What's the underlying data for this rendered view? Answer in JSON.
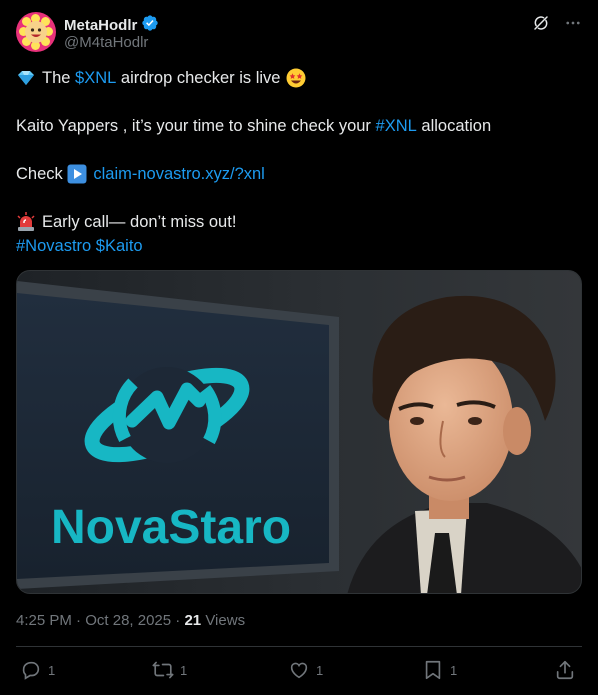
{
  "author": {
    "display_name": "MetaHodlr",
    "handle": "@M4taHodlr",
    "verified": true
  },
  "tweet": {
    "line1_pre": "The ",
    "line1_cashtag": "$XNL",
    "line1_post": " airdrop checker is live",
    "line2_pre": "Kaito Yappers , it’s your time to shine check your ",
    "line2_hashtag": "#XNL",
    "line2_post": " allocation",
    "line3_pre": "Check ",
    "line3_link": "claim-novastro.xyz/?xnl",
    "line4_text": "Early call— don’t miss out!",
    "line5_hashtag1": "#Novastro",
    "line5_cashtag": "$Kaito"
  },
  "media": {
    "logo_text": "NovaStaro",
    "accent_color": "#17b7c4"
  },
  "meta": {
    "time": "4:25 PM",
    "separator": " · ",
    "date": "Oct 28, 2025",
    "views_count": "21",
    "views_label": " Views"
  },
  "actions": {
    "replies": "1",
    "reposts": "1",
    "likes": "1",
    "bookmarks": "1"
  },
  "icons": [
    "verified-badge-icon",
    "grok-icon",
    "more-icon",
    "diamond-emoji-icon",
    "star-struck-emoji-icon",
    "play-button-emoji-icon",
    "siren-emoji-icon",
    "reply-icon",
    "repost-icon",
    "like-icon",
    "bookmark-icon",
    "share-icon"
  ],
  "colors": {
    "link": "#1d9bf0",
    "muted": "#71767b",
    "text": "#e7e9ea",
    "verified": "#1d9bf0"
  }
}
